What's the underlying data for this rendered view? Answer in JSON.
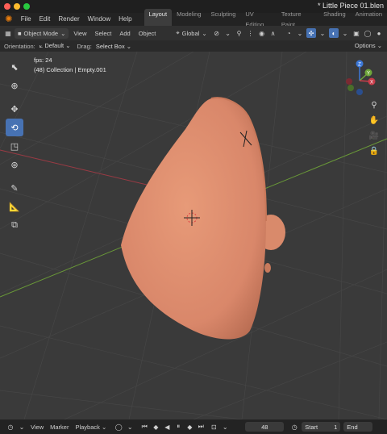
{
  "window": {
    "title": "* Little Piece 01.blen"
  },
  "menu": {
    "items": [
      "File",
      "Edit",
      "Render",
      "Window",
      "Help"
    ]
  },
  "workspaces": {
    "tabs": [
      "Layout",
      "Modeling",
      "Sculpting",
      "UV Editing",
      "Texture Paint",
      "Shading",
      "Animation"
    ],
    "active": "Layout"
  },
  "header": {
    "mode": "Object Mode",
    "view": "View",
    "select": "Select",
    "add": "Add",
    "object": "Object",
    "transform_orientation": "Global"
  },
  "tool_settings": {
    "orientation_label": "Orientation:",
    "orientation_value": "Default",
    "drag_label": "Drag:",
    "drag_value": "Select Box",
    "options": "Options"
  },
  "viewport": {
    "fps": "fps: 24",
    "context": "(48) Collection | Empty.001",
    "gizmo": {
      "z": "Z",
      "y": "Y",
      "x": "X"
    }
  },
  "timeline": {
    "view": "View",
    "marker": "Marker",
    "playback": "Playback",
    "current_frame": "48",
    "start_label": "Start",
    "start_value": "1",
    "end_label": "End"
  },
  "colors": {
    "accent": "#4772b3",
    "model": "#d98a6b",
    "axis_x": "#c83c4a",
    "axis_y": "#6fa63a",
    "axis_z": "#3c78d8"
  },
  "icons": {
    "tools": [
      "select-cursor-icon",
      "cursor-icon",
      "move-icon",
      "rotate-icon",
      "scale-icon",
      "transform-icon",
      "annotate-icon",
      "measure-icon",
      "add-cube-icon"
    ],
    "nav": [
      "zoom-icon",
      "pan-hand-icon",
      "camera-icon",
      "lock-icon"
    ]
  }
}
